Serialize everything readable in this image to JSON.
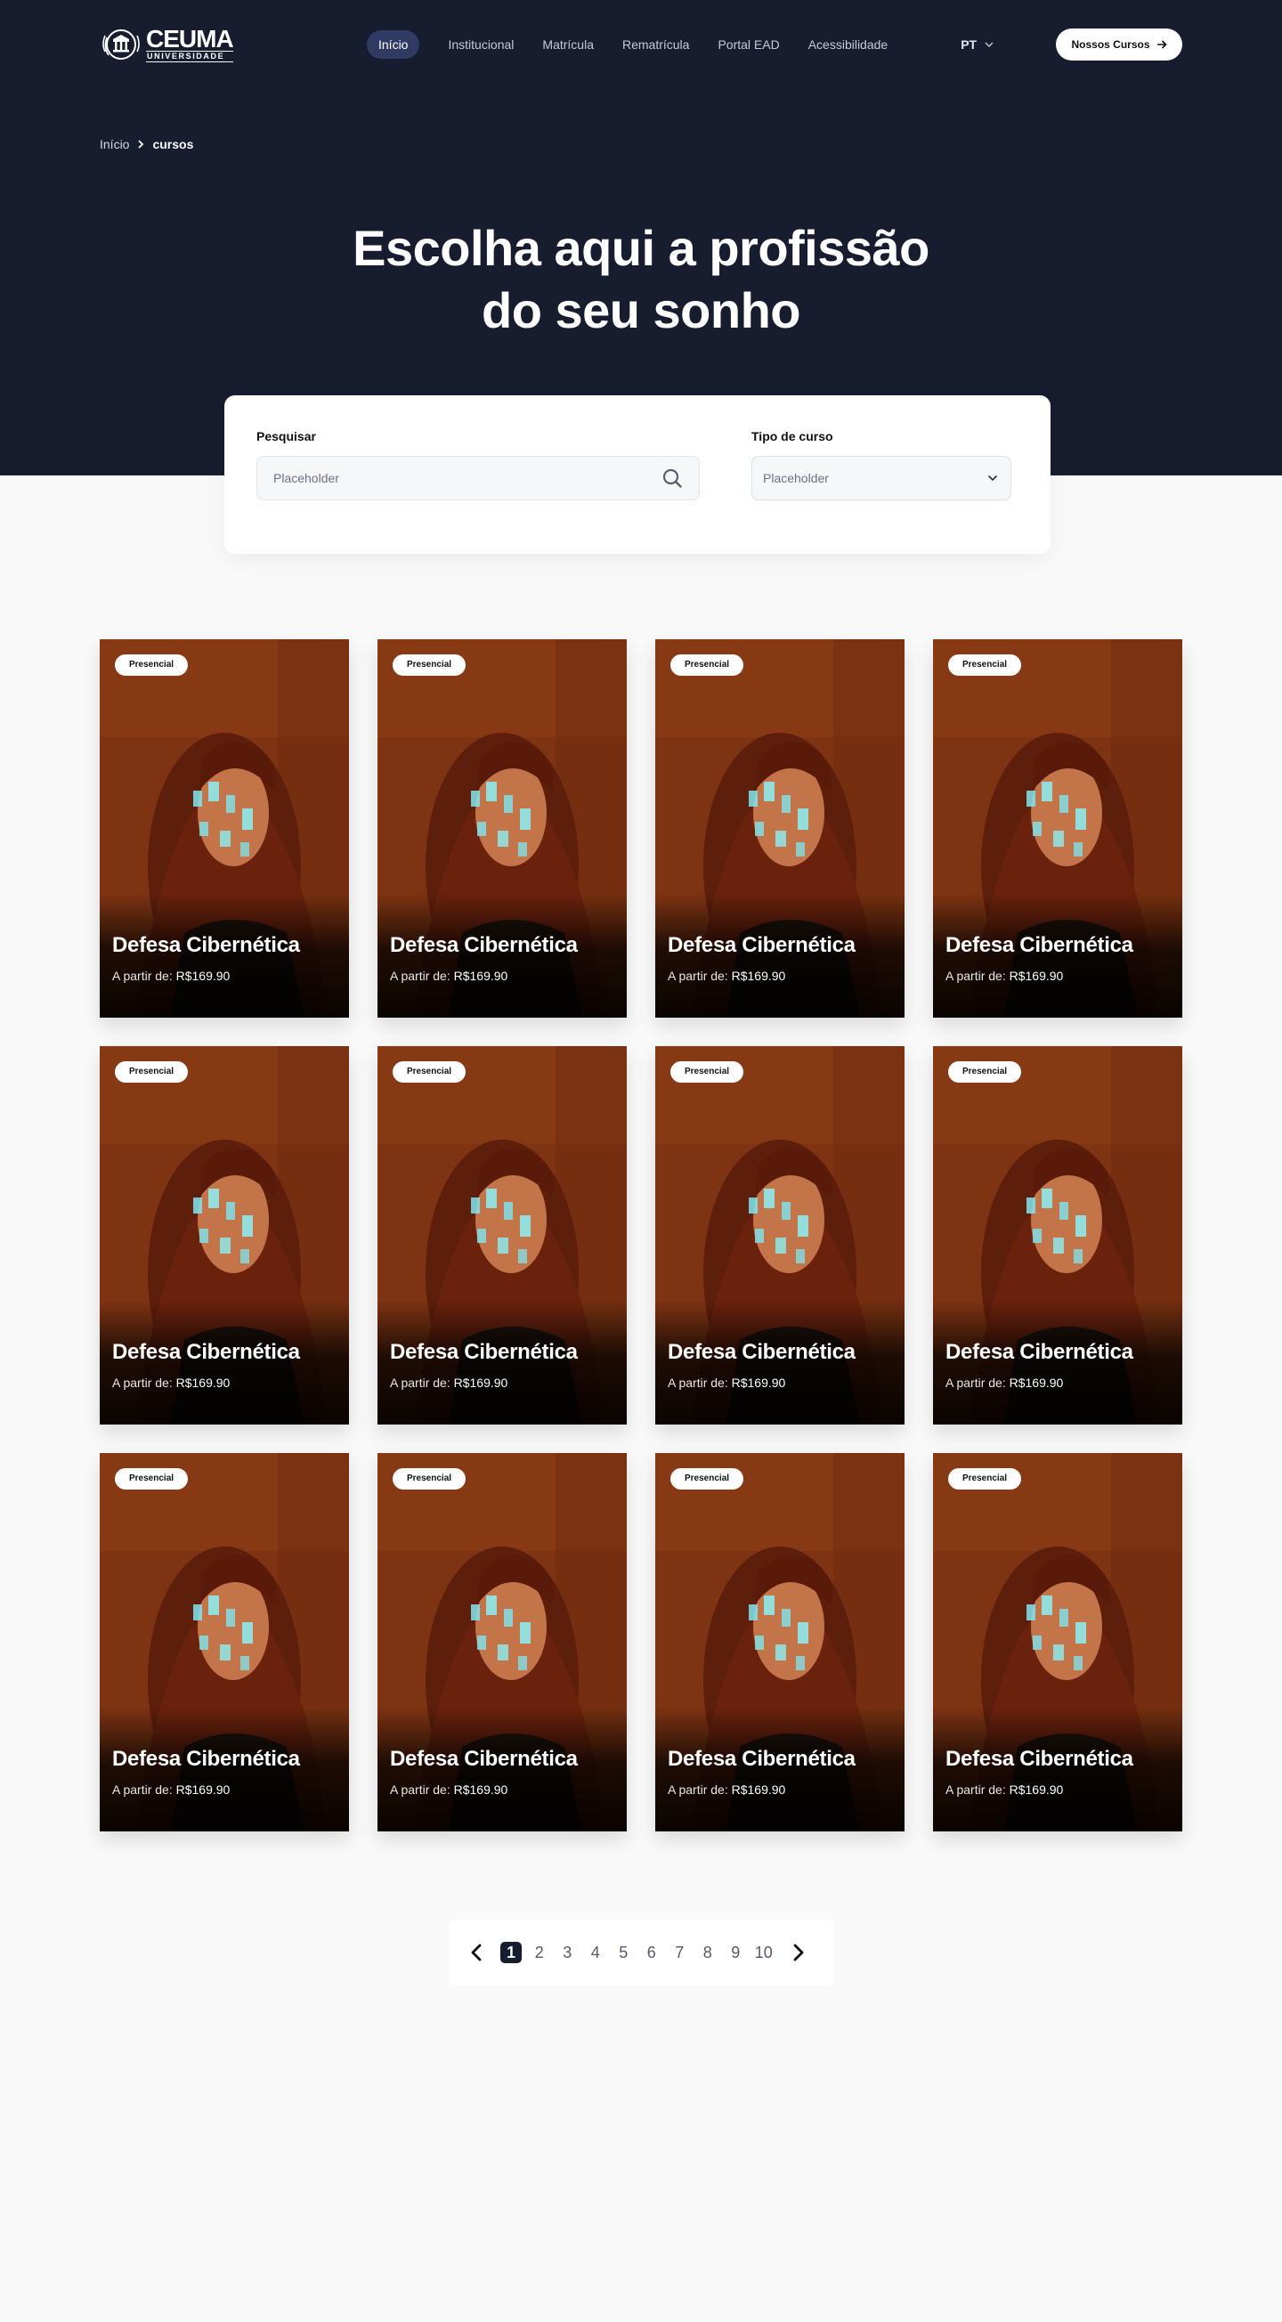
{
  "header": {
    "logo_main": "CEUMA",
    "logo_sub": "UNIVERSIDADE",
    "nav": [
      {
        "label": "Início",
        "active": true
      },
      {
        "label": "Institucional",
        "active": false
      },
      {
        "label": "Matrícula",
        "active": false
      },
      {
        "label": "Rematrícula",
        "active": false
      },
      {
        "label": "Portal EAD",
        "active": false
      },
      {
        "label": "Acessibilidade",
        "active": false
      }
    ],
    "language": "PT",
    "cta_label": "Nossos Cursos"
  },
  "breadcrumb": {
    "home": "Início",
    "current": "cursos"
  },
  "hero": {
    "title_line1": "Escolha aqui a profissão",
    "title_line2": "do seu sonho"
  },
  "search": {
    "label": "Pesquisar",
    "placeholder": "Placeholder"
  },
  "course_type": {
    "label": "Tipo de curso",
    "selected": "Placeholder"
  },
  "courses": [
    {
      "badge": "Presencial",
      "title": "Defesa Cibernética",
      "price_prefix": "A partir de:",
      "price": "R$169.90"
    },
    {
      "badge": "Presencial",
      "title": "Defesa Cibernética",
      "price_prefix": "A partir de:",
      "price": "R$169.90"
    },
    {
      "badge": "Presencial",
      "title": "Defesa Cibernética",
      "price_prefix": "A partir de:",
      "price": "R$169.90"
    },
    {
      "badge": "Presencial",
      "title": "Defesa Cibernética",
      "price_prefix": "A partir de:",
      "price": "R$169.90"
    },
    {
      "badge": "Presencial",
      "title": "Defesa Cibernética",
      "price_prefix": "A partir de:",
      "price": "R$169.90"
    },
    {
      "badge": "Presencial",
      "title": "Defesa Cibernética",
      "price_prefix": "A partir de:",
      "price": "R$169.90"
    },
    {
      "badge": "Presencial",
      "title": "Defesa Cibernética",
      "price_prefix": "A partir de:",
      "price": "R$169.90"
    },
    {
      "badge": "Presencial",
      "title": "Defesa Cibernética",
      "price_prefix": "A partir de:",
      "price": "R$169.90"
    },
    {
      "badge": "Presencial",
      "title": "Defesa Cibernética",
      "price_prefix": "A partir de:",
      "price": "R$169.90"
    },
    {
      "badge": "Presencial",
      "title": "Defesa Cibernética",
      "price_prefix": "A partir de:",
      "price": "R$169.90"
    },
    {
      "badge": "Presencial",
      "title": "Defesa Cibernética",
      "price_prefix": "A partir de:",
      "price": "R$169.90"
    },
    {
      "badge": "Presencial",
      "title": "Defesa Cibernética",
      "price_prefix": "A partir de:",
      "price": "R$169.90"
    }
  ],
  "pagination": {
    "pages": [
      "1",
      "2",
      "3",
      "4",
      "5",
      "6",
      "7",
      "8",
      "9",
      "10"
    ],
    "current": "1"
  },
  "icons": {
    "search": "search-icon",
    "dropdown": "chevron-down-icon",
    "arrow_right": "arrow-right-icon",
    "breadcrumb_separator": "chevron-right-icon",
    "prev": "chevron-left-icon",
    "next": "chevron-right-icon"
  },
  "colors": {
    "hero_bg": "#171d2f",
    "nav_active_bg": "#2f3b63",
    "page_bg": "#f9f9f9"
  }
}
